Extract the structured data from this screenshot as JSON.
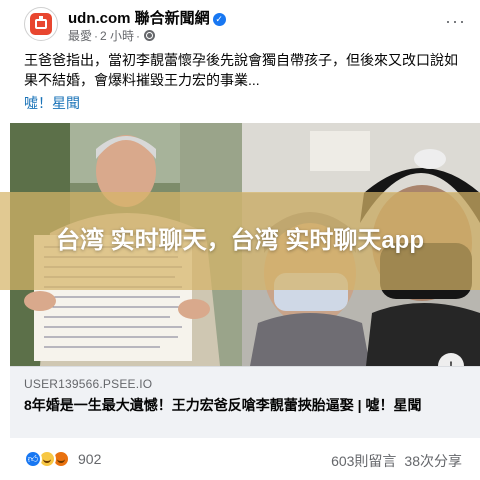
{
  "header": {
    "page_name": "udn.com 聯合新聞網",
    "meta_label": "最愛",
    "meta_sep": "·",
    "meta_time": "2 小時",
    "meta_sep2": "·"
  },
  "post": {
    "text": "王爸爸指出，當初李靚蕾懷孕後先說會獨自帶孩子，但後來又改口說如果不結婚，會爆料摧毀王力宏的事業...",
    "link_text": "噓！星聞"
  },
  "overlay": {
    "title": "台湾 实时聊天，台湾 实时聊天app"
  },
  "link_card": {
    "domain": "USER139566.PSEE.IO",
    "title": "8年婚是一生最大遺憾！王力宏爸反嗆李靚蕾挾胎逼娶 | 噓！星聞"
  },
  "stats": {
    "reaction_count": "902",
    "comments": "603則留言",
    "shares": "38次分享"
  },
  "icons": {
    "verified": "verified-icon",
    "globe": "globe-icon",
    "more": "more-icon",
    "info": "info-icon",
    "like": "like-icon",
    "haha": "haha-icon",
    "angry": "angry-icon"
  },
  "colors": {
    "brand_red": "#e8462f",
    "link_blue": "#1a73b8",
    "verified_blue": "#1877f2",
    "overlay_band": "#d6b468",
    "card_bg": "#f0f2f5"
  }
}
